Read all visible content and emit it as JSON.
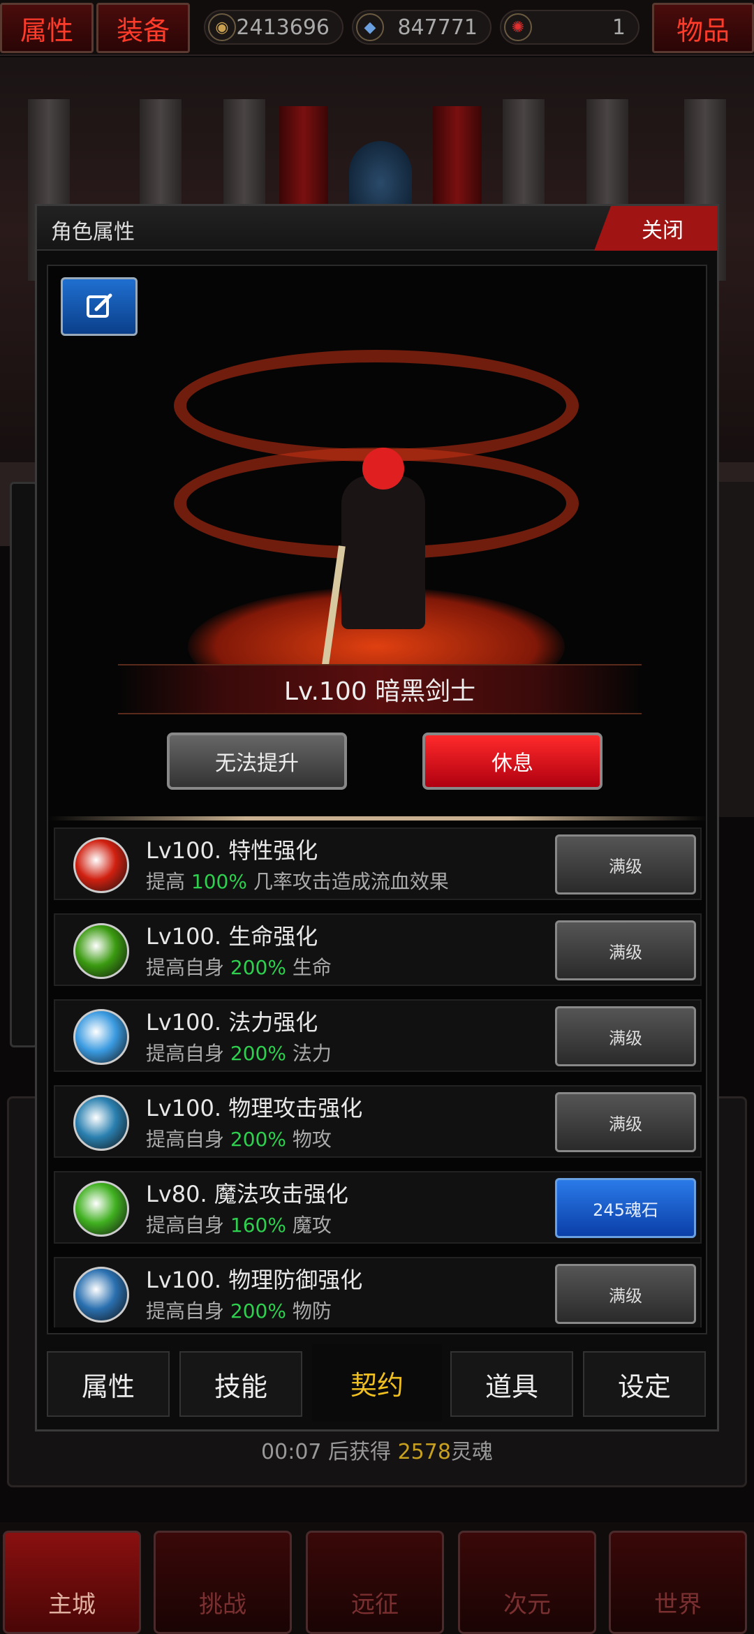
{
  "topbar": {
    "attr_tab": "属性",
    "equip_tab": "装备",
    "items_tab": "物品",
    "gold": "2413696",
    "gems": "847771",
    "tokens": "1"
  },
  "modal": {
    "title": "角色属性",
    "close": "关闭",
    "level_name": "Lv.100 暗黑剑士",
    "upgrade_btn": "无法提升",
    "rest_btn": "休息"
  },
  "skills": [
    {
      "title": "Lv100. 特性强化",
      "pre": "提高 ",
      "pct": "100%",
      "post": " 几率攻击造成流血效果",
      "btn": "满级",
      "color": "#d02010"
    },
    {
      "title": "Lv100. 生命强化",
      "pre": "提高自身 ",
      "pct": "200%",
      "post": " 生命",
      "btn": "满级",
      "color": "#3a9a10"
    },
    {
      "title": "Lv100. 法力强化",
      "pre": "提高自身 ",
      "pct": "200%",
      "post": " 法力",
      "btn": "满级",
      "color": "#3a9ae0"
    },
    {
      "title": "Lv100. 物理攻击强化",
      "pre": "提高自身 ",
      "pct": "200%",
      "post": " 物攻",
      "btn": "满级",
      "color": "#2a80b0"
    },
    {
      "title": "Lv80. 魔法攻击强化",
      "pre": "提高自身 ",
      "pct": "160%",
      "post": " 魔攻",
      "btn": "245魂石",
      "color": "#40b020"
    },
    {
      "title": "Lv100. 物理防御强化",
      "pre": "提高自身 ",
      "pct": "200%",
      "post": " 物防",
      "btn": "满级",
      "color": "#2a70b0"
    }
  ],
  "tabs": [
    "属性",
    "技能",
    "契约",
    "道具",
    "设定"
  ],
  "active_tab": "契约",
  "timer": {
    "time": "00:07",
    "mid": " 后获得 ",
    "amount": "2578",
    "unit": "灵魂"
  },
  "nav": [
    "主城",
    "挑战",
    "远征",
    "次元",
    "世界"
  ]
}
